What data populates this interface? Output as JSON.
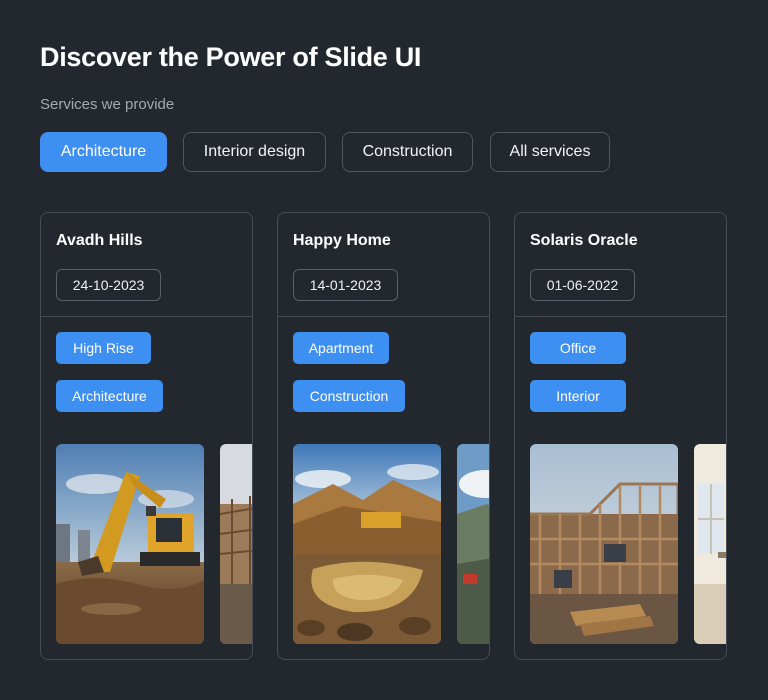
{
  "header": {
    "title": "Discover the Power of Slide UI",
    "subtitle": "Services we provide"
  },
  "filters": [
    {
      "label": "Architecture",
      "active": true
    },
    {
      "label": "Interior design",
      "active": false
    },
    {
      "label": "Construction",
      "active": false
    },
    {
      "label": "All services",
      "active": false
    }
  ],
  "cards": [
    {
      "name": "Avadh Hills",
      "date": "24-10-2023",
      "tags": [
        "High Rise",
        "Architecture"
      ]
    },
    {
      "name": "Happy Home",
      "date": "14-01-2023",
      "tags": [
        "Apartment",
        "Construction"
      ]
    },
    {
      "name": "Solaris Oracle",
      "date": "01-06-2022",
      "tags": [
        "Office",
        "Interior"
      ]
    }
  ],
  "colors": {
    "background": "#23282f",
    "accent": "#3d8ff2",
    "border": "#454c55",
    "muted_text": "#a3a9b1"
  }
}
